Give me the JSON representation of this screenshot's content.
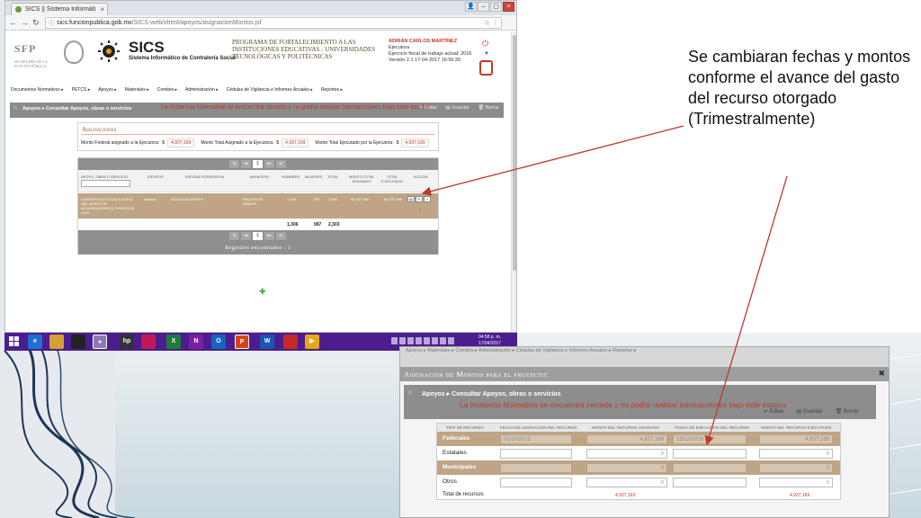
{
  "browser": {
    "tab_title": "SICS || Sistema Informáti",
    "url_host": "sics.funcionpublica.gob.mx",
    "url_path": "/SICS-web/xhtml/apoyos/asignacionMontos.jsf"
  },
  "header": {
    "sfp": "SFP",
    "sfp_sub": "SECRETARÍA DE LA FUNCIÓN PÚBLICA",
    "sics_title": "SICS",
    "sics_subtitle": "Sistema Informático de Contraloría Social",
    "program_title": "PROGRAMA DE FORTALECIMIENTO A LAS INSTITUCIONES EDUCATIVAS - UNIVERSIDADES TECNOLÓGICAS Y POLITÉCNICAS",
    "user_name": "ADRIÁN CARLOS MARTÍNEZ",
    "user_role": "Ejecutora",
    "fiscal_year": "Ejercicio fiscal de trabajo actual: 2016",
    "version": "Versión 2.1    17-04-2017 16:56:20"
  },
  "nav": [
    "Documentos Normativos ▸",
    "PETCS ▸",
    "Apoyos ▸",
    "Materiales ▸",
    "Comites ▸",
    "Administración ▸",
    "Cédulas de Vigilancia e Informes Anuales ▸",
    "Reportes ▸"
  ],
  "toolbar": {
    "crumb_1": "Apoyos",
    "crumb_2": "Consultar Apoyos, obras o servicios",
    "warning": "La Instancia Normativa se encuentra cerrada y no podra realizar transacciones bajo este estatus",
    "editar": "Editar",
    "guardar": "Guardar",
    "borrar": "Borrar"
  },
  "asignaciones": {
    "title": "Asignaciones",
    "federal_label": "Monto Federal asignado a la Ejecutora:",
    "federal_value": "4,937,169",
    "total_label": "Monto Total Asignado a la Ejecutora:",
    "total_value": "4,937,169",
    "ejercido_label": "Monto Total Ejecutado por la Ejecutora:",
    "ejercido_value": "4,937,169",
    "currency": "$"
  },
  "grid": {
    "pager": [
      "|◂",
      "◂◂",
      "1",
      "▸▸",
      "▸|"
    ],
    "headers": [
      "Apoyo, obra o servicio",
      "Estatus",
      "Entidad Federativa",
      "Municipio",
      "Hombres",
      "Mujeres",
      "Total",
      "Monto Total Asignado",
      "Total Ejecutado",
      "Acción"
    ],
    "row": {
      "apoyo": "UNIVERSIDAD TECNOLÓGICA DEL NORTE DE AGUASCALIENTES, PROFOCIE 2015",
      "estatus": "Iniciado",
      "entidad": "AGUASCALIENTES",
      "municipio": "RINCÓN DE ROMOS",
      "hombres": "1,306",
      "mujeres": "997",
      "total": "2,303",
      "monto": "$4,937,169",
      "ejecutado": "$4,937,169",
      "zero": "0"
    },
    "totals": {
      "hombres": "1,306",
      "mujeres": "997",
      "total": "2,303"
    },
    "registros": "Registros encontrados : 1"
  },
  "taskbar": {
    "apps": [
      "e",
      "",
      "",
      "",
      "hp",
      "",
      "X",
      "N",
      "O",
      "P",
      "W",
      "",
      ""
    ],
    "time": "04:58 p. m.",
    "date": "17/04/2017"
  },
  "callout": "Se cambiaran fechas y montos conforme el avance del  gasto del recurso otorgado (Trimestralmente)",
  "modal": {
    "nav_text": "Apoyos ▸   Materiales ▸   Comites ▸   Administración ▸   Cédulas de Vigilancia e Informes Anuales ▸   Reportes ▸",
    "title": "Asignación de Montos para el proyecto:",
    "close": "✖",
    "crumb_1": "Apoyos",
    "crumb_2": "Consultar Apoyos, obras o servicios",
    "warning": "La Instancia Normativa se encuentra cerrada y no podra realizar transacciones bajo este estatus",
    "editar": "Editar",
    "guardar": "Guardar",
    "borrar": "Borrar",
    "headers": [
      "Tipo de Recurso",
      "Fecha de Asignación del Recurso",
      "Monto del Recurso Asignado",
      "Fecha de Ejecución del Recurso",
      "Monto del Recurso Ejecutado"
    ],
    "rows": [
      {
        "tipo": "Federales",
        "fecha_asig": "01/10/2015",
        "monto_asig": "4,937,169",
        "fecha_ejec": "15/12/2016",
        "monto_ejec": "4,937,169"
      },
      {
        "tipo": "Estatales",
        "fecha_asig": "",
        "monto_asig": "0",
        "fecha_ejec": "",
        "monto_ejec": "0"
      },
      {
        "tipo": "Municipales",
        "fecha_asig": "",
        "monto_asig": "0",
        "fecha_ejec": "",
        "monto_ejec": "0"
      },
      {
        "tipo": "Otros",
        "fecha_asig": "",
        "monto_asig": "0",
        "fecha_ejec": "",
        "monto_ejec": "0"
      }
    ],
    "total_label": "Total de recursos",
    "total_asignado": "4,937,169",
    "total_ejecutado": "4,937,169"
  },
  "colors": {
    "accent_red": "#c0392b",
    "row_brown": "#bfa585",
    "toolbar_gray": "#8b8b8b",
    "taskbar": "#4b1d8f"
  },
  "icons": [
    "shield-icon",
    "power-icon",
    "home-icon",
    "pencil-icon",
    "save-icon",
    "trash-icon",
    "close-icon",
    "star-icon",
    "menu-icon",
    "windows-start-icon"
  ]
}
